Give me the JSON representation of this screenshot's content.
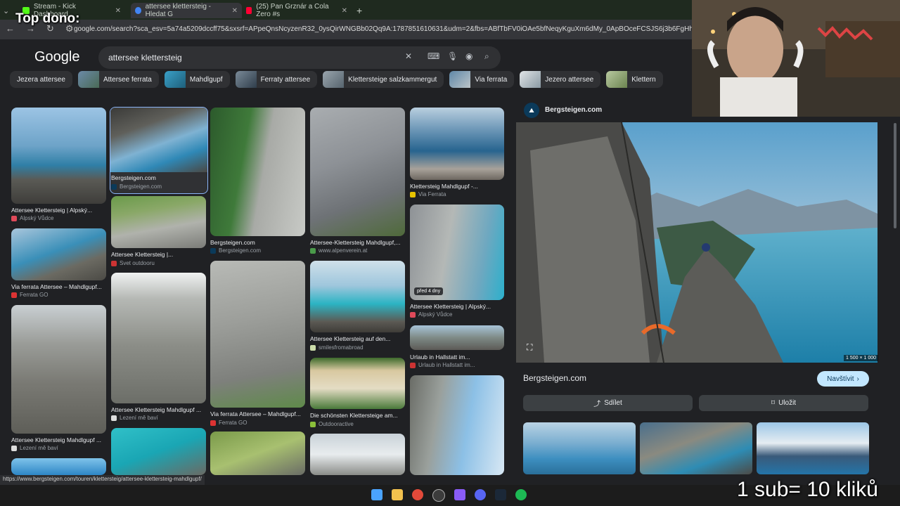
{
  "browser": {
    "tabs": [
      {
        "title": "Stream - Kick Dashboard",
        "favicon_color": "#53fc18"
      },
      {
        "title": "attersee klettersteig - Hledat G",
        "favicon_color": "#4285f4"
      },
      {
        "title": "(25) Pan Grznár a Cola Zero #s",
        "favicon_color": "#ff0033"
      }
    ],
    "url": "google.com/search?sca_esv=5a74a5209dccff75&sxsrf=APpeQnsNcyzenR32_0ysQirWNGBb02Qq9A:1787851610631&udm=2&fbs=ABfTbFV0iOAe5bfNeqyKguXm6dMy_0ApBOceFCSJS6j3b6FgHhiePJsdpZG-T28G_MI",
    "status_url": "https://www.bergsteigen.com/touren/klettersteig/attersee-klettersteig-mahdlgupf/"
  },
  "overlay": {
    "top_dono": "Top dono:",
    "subs": "1 sub= 10 kliků"
  },
  "google": {
    "logo": "Google",
    "query": "attersee klettersteig"
  },
  "chips": [
    "Jezera attersee",
    "Attersee ferrata",
    "Mahdlgupf",
    "Ferraty attersee",
    "Klettersteige salzkammergut",
    "Via ferrata",
    "Jezero attersee",
    "Klettern"
  ],
  "results": {
    "c1": [
      {
        "caption": "Attersee Klettersteig | Alpský...",
        "source": "Alpský Vůdce",
        "src_color": "#e04a5a"
      },
      {
        "caption": "Via ferrata Attersee – Mahdlgupf...",
        "source": "Ferrata GO",
        "src_color": "#d33"
      },
      {
        "caption": "Attersee Klettersteig Mahdlgupf ...",
        "source": "Lezení mě baví",
        "src_color": "#ddd"
      }
    ],
    "c2": [
      {
        "caption": "Bergsteigen.com",
        "source": "Bergsteigen.com",
        "src_color": "#0b3a5a"
      },
      {
        "caption": "Attersee Klettersteig |...",
        "source": "Svet outdooru",
        "src_color": "#c33"
      },
      {
        "caption": "Attersee Klettersteig Mahdlgupf ...",
        "source": "Lezení mě baví",
        "src_color": "#ddd"
      }
    ],
    "c3": [
      {
        "caption": "Bergsteigen.com",
        "source": "Bergsteigen.com",
        "src_color": "#0b3a5a"
      },
      {
        "caption": "Via ferrata Attersee – Mahdlgupf...",
        "source": "Ferrata GO",
        "src_color": "#d33"
      }
    ],
    "c4": [
      {
        "caption": "Attersee-Klettersteig Mahdlgupf,...",
        "source": "www.alpenverein.at",
        "src_color": "#4a9a4a"
      },
      {
        "caption": "Attersee Klettersteig auf den...",
        "source": "smilesfromabroad",
        "src_color": "#cda"
      },
      {
        "caption": "Die schönsten Klettersteige am...",
        "source": "Outdooractive",
        "src_color": "#8bbf3a"
      }
    ],
    "c5": [
      {
        "caption": "Klettersteig Mahdlgupf -...",
        "source": "Via Ferrata",
        "src_color": "#e6c200"
      },
      {
        "caption": "Attersee Klettersteig | Alpský...",
        "source": "Alpský Vůdce",
        "src_color": "#e04a5a"
      },
      {
        "caption": "Urlaub in Hallstatt im...",
        "source": "Urlaub in Hallstatt im...",
        "src_color": "#c33"
      }
    ],
    "badge_time": "před 4 dny"
  },
  "panel": {
    "site_header": "Bergsteigen.com",
    "image_size": "1 500 × 1 000",
    "title": "Bergsteigen.com",
    "visit": "Navštívit",
    "share": "Sdílet",
    "save": "Uložit"
  }
}
